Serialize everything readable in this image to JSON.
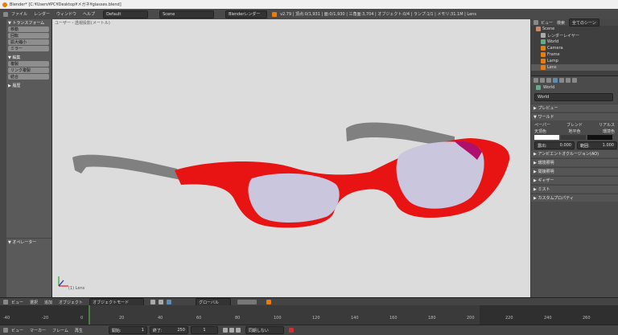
{
  "titlebar": {
    "title": "Blender* [C:¥Users¥PC¥Desktop¥メガネ¥glasses.blend]"
  },
  "infobar": {
    "menus": [
      "ファイル",
      "レンダー",
      "ウィンドウ",
      "ヘルプ"
    ],
    "layout": "Default",
    "scene": "Scene",
    "engine": "Blenderレンダー",
    "stats": "v2.79 | 頂点:0/1,931 | 面:0/1,930 | 三角面:3,704 | オブジェクト:0/4 | ランプ:1/1 | メモリ:31.1M | Lens"
  },
  "viewport": {
    "header_text": "ユーザー・透視投影(メートル)",
    "object_label": "(1) Lens"
  },
  "toolshelf": {
    "transform_header": "▼ トランスフォーム",
    "transform_buttons": [
      "移動",
      "回転",
      "拡大縮小",
      "ミラー"
    ],
    "edit_header": "▼ 編集",
    "edit_buttons": [
      "複製",
      "リンク複製",
      "結合"
    ],
    "history_header": "▶ 履歴",
    "operator_header": "▼ オペレーター"
  },
  "outliner": {
    "view": "ビュー",
    "search": "検索",
    "filter": "全てのシーン",
    "items": [
      "Scene",
      "レンダーレイヤー",
      "World",
      "Camera",
      "Frame",
      "Lamp",
      "Lens"
    ]
  },
  "properties": {
    "world_name": "World",
    "sections": [
      "プレビュー",
      "ワールド"
    ],
    "world_options": [
      "ペーパー",
      "ブレンド",
      "リアルス"
    ],
    "color_labels": [
      "天頂色",
      "地平色",
      "環境色"
    ],
    "exposure_label": "露出:",
    "exposure_value": "0.000",
    "range_label": "範囲:",
    "range_value": "1.000",
    "closed_sections": [
      "アンビエントオクルージョン(AO)",
      "環境照明",
      "間接照明",
      "ギャザー",
      "ミスト",
      "カスタムプロパティ"
    ]
  },
  "view3d_header": {
    "menus": [
      "ビュー",
      "選択",
      "追加",
      "オブジェクト"
    ],
    "mode": "オブジェクトモード",
    "pivot": "グローバル"
  },
  "timeline": {
    "ticks": [
      "-40",
      "-20",
      "0",
      "20",
      "40",
      "60",
      "80",
      "100",
      "120",
      "140",
      "160",
      "180",
      "200",
      "220",
      "240",
      "260"
    ],
    "menus": [
      "ビュー",
      "マーカー",
      "フレーム",
      "再生"
    ],
    "start_label": "開始:",
    "start_value": "1",
    "end_label": "終了:",
    "end_value": "250",
    "current": "1",
    "sync": "同期しない"
  },
  "colors": {
    "frame": "#e81414",
    "lens": "#c9c6de",
    "temple": "#7f7f7f",
    "viewport_bg": "#dcdcdc"
  }
}
